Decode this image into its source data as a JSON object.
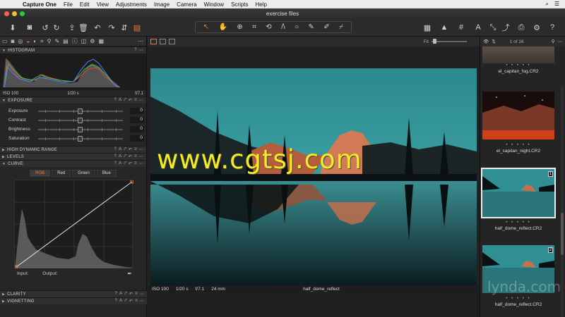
{
  "menubar": {
    "app_name": "Capture One",
    "items": [
      "File",
      "Edit",
      "View",
      "Adjustments",
      "Image",
      "Camera",
      "Window",
      "Scripts",
      "Help"
    ]
  },
  "window": {
    "title": "exercise files"
  },
  "toolbar": {
    "left_icons": [
      "import-icon",
      "camera-icon",
      "rotate-left-icon",
      "rotate-right-icon",
      "export-icon",
      "trash-icon",
      "undo-icon",
      "redo-icon",
      "copy-icon",
      "layers-icon"
    ],
    "cursor_tools": [
      "select-arrow",
      "pan-hand",
      "zoom",
      "crop",
      "rotate",
      "keystone",
      "spot-circle",
      "draw-mask",
      "erase-mask",
      "picker"
    ],
    "right_icons": [
      "grid-view-icon",
      "exposure-warning-icon",
      "grid-overlay-icon",
      "text-overlay-icon",
      "before-after-icon",
      "process-icon",
      "print-icon",
      "settings-icon",
      "help-icon"
    ]
  },
  "tool_tabs": [
    "library",
    "capture",
    "lens",
    "color",
    "exposure",
    "composition",
    "details",
    "local",
    "adjustments",
    "metadata",
    "output",
    "batch"
  ],
  "histogram": {
    "header": "HISTOGRAM",
    "iso": "ISO 100",
    "shutter": "1/20 s",
    "aperture": "f/7.1"
  },
  "exposure": {
    "header": "EXPOSURE",
    "sliders": [
      {
        "label": "Exposure",
        "value": "0"
      },
      {
        "label": "Contrast",
        "value": "0"
      },
      {
        "label": "Brightness",
        "value": "0"
      },
      {
        "label": "Saturation",
        "value": "0"
      }
    ]
  },
  "collapsed_sections": [
    "HIGH DYNAMIC RANGE",
    "LEVELS"
  ],
  "curve": {
    "header": "CURVE",
    "tabs": [
      "RGB",
      "Red",
      "Green",
      "Blue"
    ],
    "active_tab": "RGB",
    "input_label": "Input:",
    "output_label": "Output:"
  },
  "bottom_sections": [
    "CLARITY",
    "VIGNETTING"
  ],
  "viewer": {
    "zoom_label": "Fit",
    "status": {
      "iso": "ISO 100",
      "shutter": "1/20 s",
      "aperture": "f/7.1",
      "focal": "24 mm",
      "filename": "half_dome_reflect"
    }
  },
  "browser": {
    "count": "1 of 26",
    "items": [
      {
        "name": "el_capitan_fog.CR2",
        "number": ""
      },
      {
        "name": "el_capitan_night.CR2",
        "number": ""
      },
      {
        "name": "half_dome_reflect.CR2",
        "number": "1",
        "selected": true
      },
      {
        "name": "half_dome_reflect.CR2",
        "number": "2"
      }
    ]
  },
  "watermark": "www.cgtsj.com",
  "brand_watermark": "lynda.com",
  "colors": {
    "accent": "#f07a35",
    "watermark": "#f4ec1e"
  }
}
